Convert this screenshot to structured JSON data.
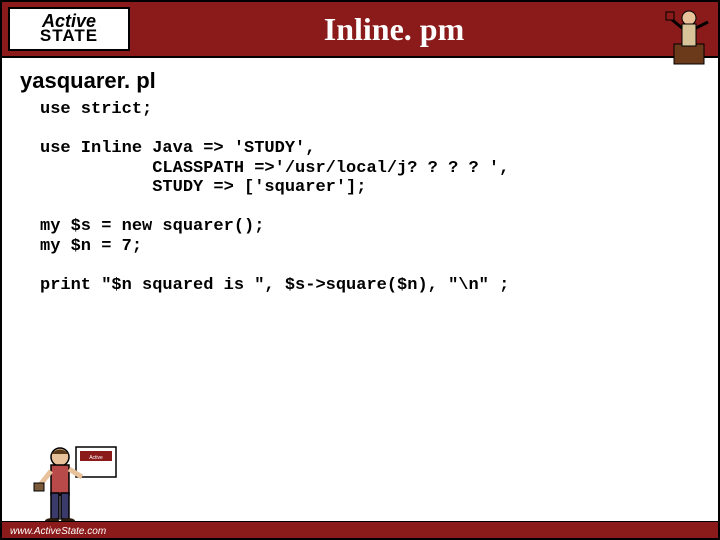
{
  "header": {
    "logo_top": "Active",
    "logo_bottom": "STATE",
    "title": "Inline. pm"
  },
  "subtitle": "yasquarer. pl",
  "code": "use strict;\n\nuse Inline Java => 'STUDY',\n           CLASSPATH =>'/usr/local/j? ? ? ? ',\n           STUDY => ['squarer'];\n\nmy $s = new squarer();\nmy $n = 7;\n\nprint \"$n squared is \", $s->square($n), \"\\n\" ;",
  "footer": {
    "url": "www.ActiveState.com"
  }
}
